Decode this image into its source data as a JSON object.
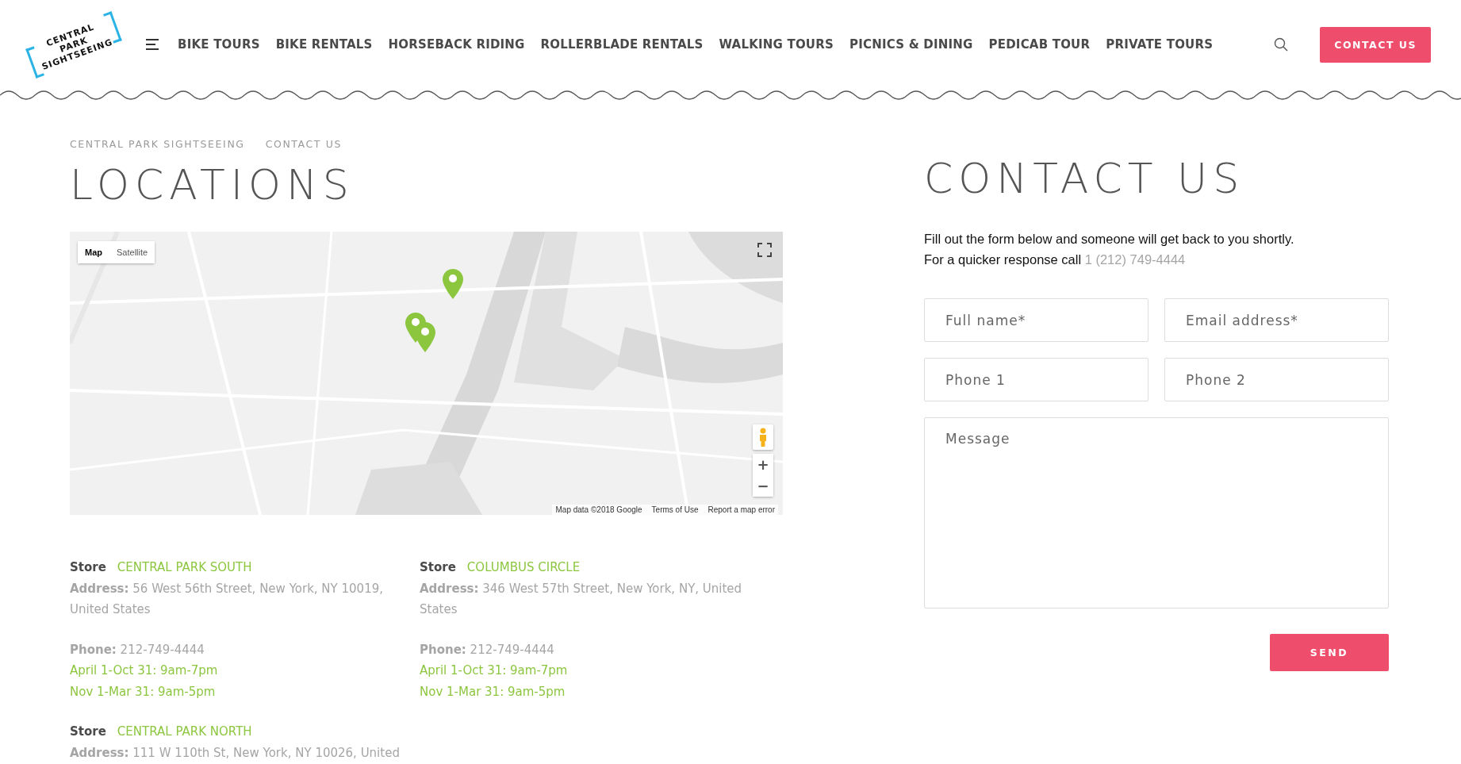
{
  "header": {
    "logo": [
      "CENTRAL",
      "PARK",
      "SIGHTSEEING"
    ],
    "nav": [
      "BIKE TOURS",
      "BIKE RENTALS",
      "HORSEBACK RIDING",
      "ROLLERBLADE RENTALS",
      "WALKING TOURS",
      "PICNICS & DINING",
      "PEDICAB TOUR",
      "PRIVATE TOURS"
    ],
    "cta": "CONTACT US"
  },
  "breadcrumb": [
    "CENTRAL PARK SIGHTSEEING",
    "CONTACT US"
  ],
  "locations": {
    "title": "LOCATIONS",
    "map": {
      "kind": "picture",
      "view_buttons": [
        {
          "label": "Map",
          "selected": true
        },
        {
          "label": "Satellite",
          "selected": false
        }
      ],
      "zoom": [
        "+",
        "−"
      ],
      "attribution": [
        "Map data ©2018 Google",
        "Terms of Use",
        "Report a map error"
      ]
    },
    "stores": [
      {
        "label": "Store",
        "name": "CENTRAL PARK SOUTH",
        "address": "**Address:** 56 West 56th Street, New York, NY 10019, United States",
        "phone": "**Phone:** 212-749-4444",
        "hours": [
          "April 1-Oct 31: 9am-7pm",
          "Nov 1-Mar 31: 9am-5pm"
        ]
      },
      {
        "label": "Store",
        "name": "COLUMBUS CIRCLE",
        "address": "**Address:** 346 West 57th Street, New York, NY, United States",
        "phone": "**Phone:** 212-749-4444",
        "hours": [
          "April 1-Oct 31: 9am-7pm",
          "Nov 1-Mar 31: 9am-5pm"
        ]
      },
      {
        "label": "Store",
        "name": "CENTRAL PARK NORTH",
        "address": "**Address:** 111 W 110th St, New York, NY 10026, United"
      }
    ]
  },
  "contact": {
    "title": "CONTACT US",
    "intro": "Fill out the form below and someone will get back to you shortly.",
    "call_text": "For a quicker response call",
    "call_phone": "1 (212) 749-4444",
    "fields": [
      {
        "placeholder": "Full name*"
      },
      {
        "placeholder": "Email address*"
      },
      {
        "placeholder": "Phone 1"
      },
      {
        "placeholder": "Phone 2"
      }
    ],
    "message": {
      "placeholder": "Message"
    },
    "submit": "SEND"
  }
}
